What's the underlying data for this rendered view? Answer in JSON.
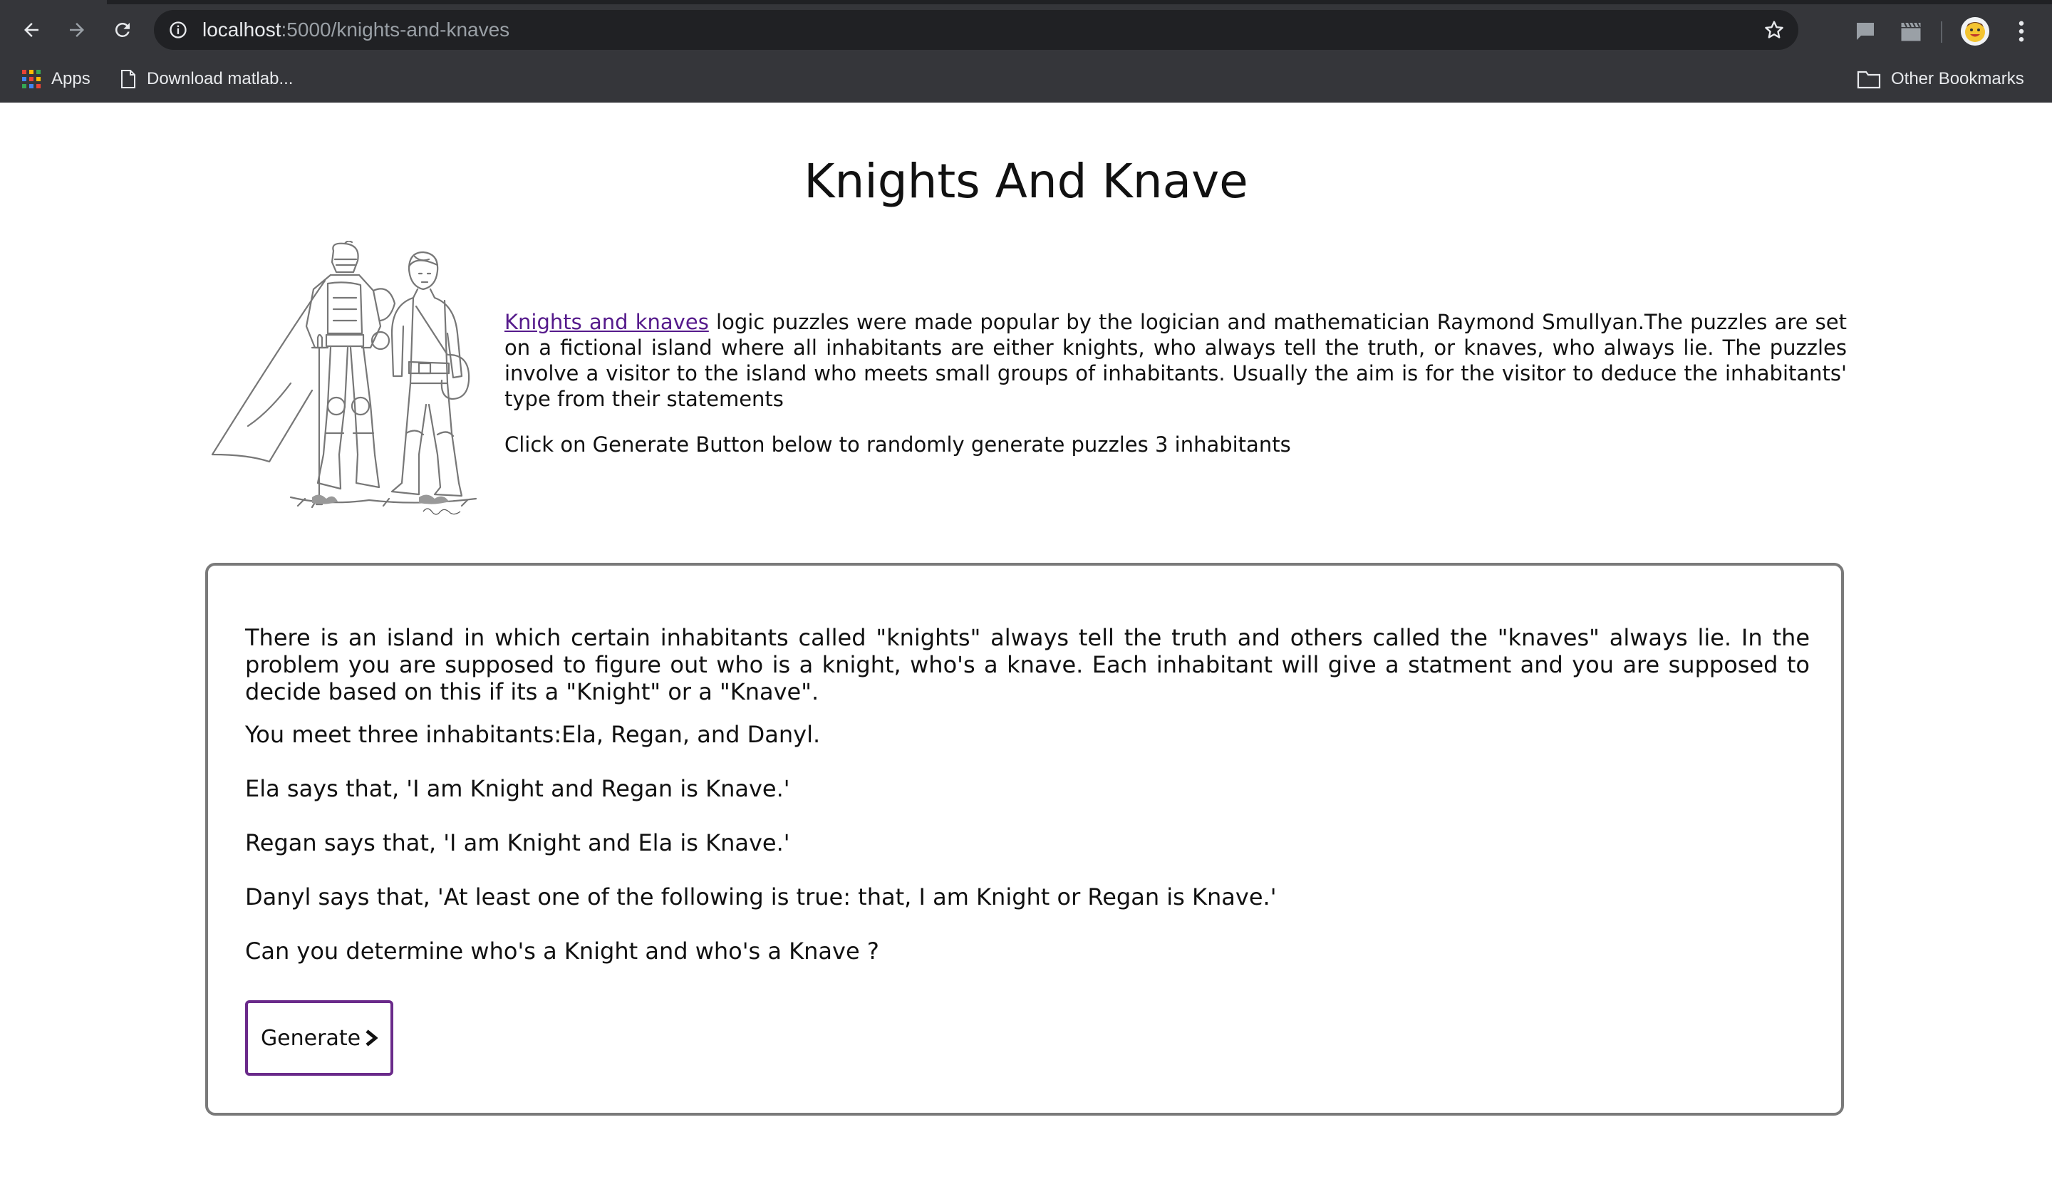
{
  "browser": {
    "url_host": "localhost",
    "url_path": ":5000/knights-and-knaves",
    "bookmarks": {
      "apps_label": "Apps",
      "item1_label": "Download matlab...",
      "other_label": "Other Bookmarks"
    },
    "icons": [
      "back-icon",
      "forward-icon",
      "reload-icon",
      "info-icon",
      "star-icon",
      "chat-icon",
      "clapper-icon",
      "avatar",
      "menu-dots-icon",
      "apps-grid-icon",
      "page-icon",
      "folder-icon"
    ]
  },
  "page": {
    "title": "Knights And Knave",
    "intro": {
      "link_text": "Knights and knaves",
      "body": " logic puzzles were made popular by the logician and mathematician Raymond Smullyan.The puzzles are set on a fictional island where all inhabitants are either knights, who always tell the truth, or knaves, who always lie. The puzzles involve a visitor to the island who meets small groups of inhabitants. Usually the aim is for the visitor to deduce the inhabitants' type from their statements",
      "instruction": "Click on Generate Button below to randomly generate puzzles 3 inhabitants"
    },
    "puzzle": {
      "description": "There is an island in which certain inhabitants called \"knights\" always tell the truth and others called the \"knaves\" always lie. In the problem you are supposed to figure out who is a knight, who's a knave. Each inhabitant will give a statment and you are supposed to decide based on this if its a \"Knight\" or a \"Knave\".",
      "meet": "You meet three inhabitants:Ela, Regan, and Danyl.",
      "statement1": "Ela says that, 'I am Knight and Regan is Knave.'",
      "statement2": "Regan says that, 'I am Knight and Ela is Knave.'",
      "statement3": "Danyl says that, 'At least one of the following is true: that, I am Knight or Regan is Knave.'",
      "question": "Can you determine who's a Knight and who's a Knave ?",
      "generate_label": "Generate"
    }
  },
  "colors": {
    "chrome_bg": "#35363a",
    "omnibox_bg": "#202124",
    "link": "#551a8b",
    "button_border": "#6a2a8a",
    "box_border": "#7a7a7a"
  }
}
